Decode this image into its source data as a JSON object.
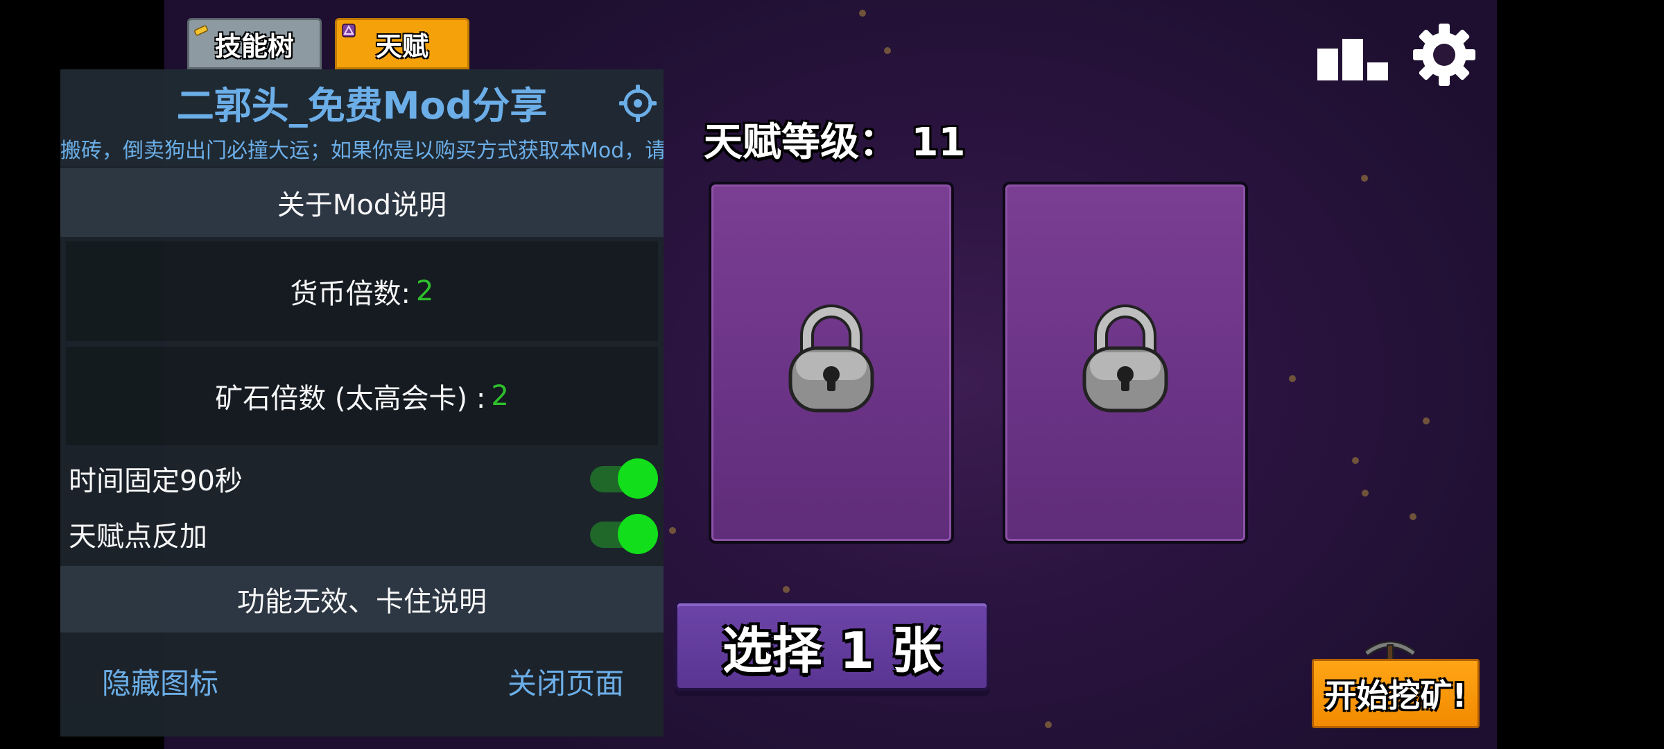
{
  "tabs": {
    "skill_tree": "技能树",
    "talent": "天赋"
  },
  "talent": {
    "level_text": "天赋等级：  11"
  },
  "cards": {
    "select_label": "选择 1 张"
  },
  "start_mining": {
    "label": "开始挖矿!"
  },
  "mod_panel": {
    "title": "二郭头_免费Mod分享",
    "marquee": "搬砖，倒卖狗出门必撞大运；如果你是以购买方式获取本Mod，请",
    "about_button": "关于Mod说明",
    "currency_label": "货币倍数: ",
    "currency_value": "2",
    "ore_label": "矿石倍数 (太高会卡) : ",
    "ore_value": "2",
    "toggle_time_label": "时间固定90秒",
    "toggle_talent_label": "天赋点反加",
    "toggle_time_on": true,
    "toggle_talent_on": true,
    "help_button": "功能无效、卡住说明",
    "hide_icon": "隐藏图标",
    "close_page": "关闭页面"
  },
  "colors": {
    "accent_blue": "#6fb4ee",
    "value_green": "#2fc72c",
    "switch_on": "#12e51a",
    "card_purple": "#6a3385",
    "orange": "#f5a10a"
  },
  "icons": [
    "stats-bar-icon",
    "settings-gear-icon",
    "padlock-icon",
    "pickaxe-icon",
    "panel-settings-icon"
  ]
}
